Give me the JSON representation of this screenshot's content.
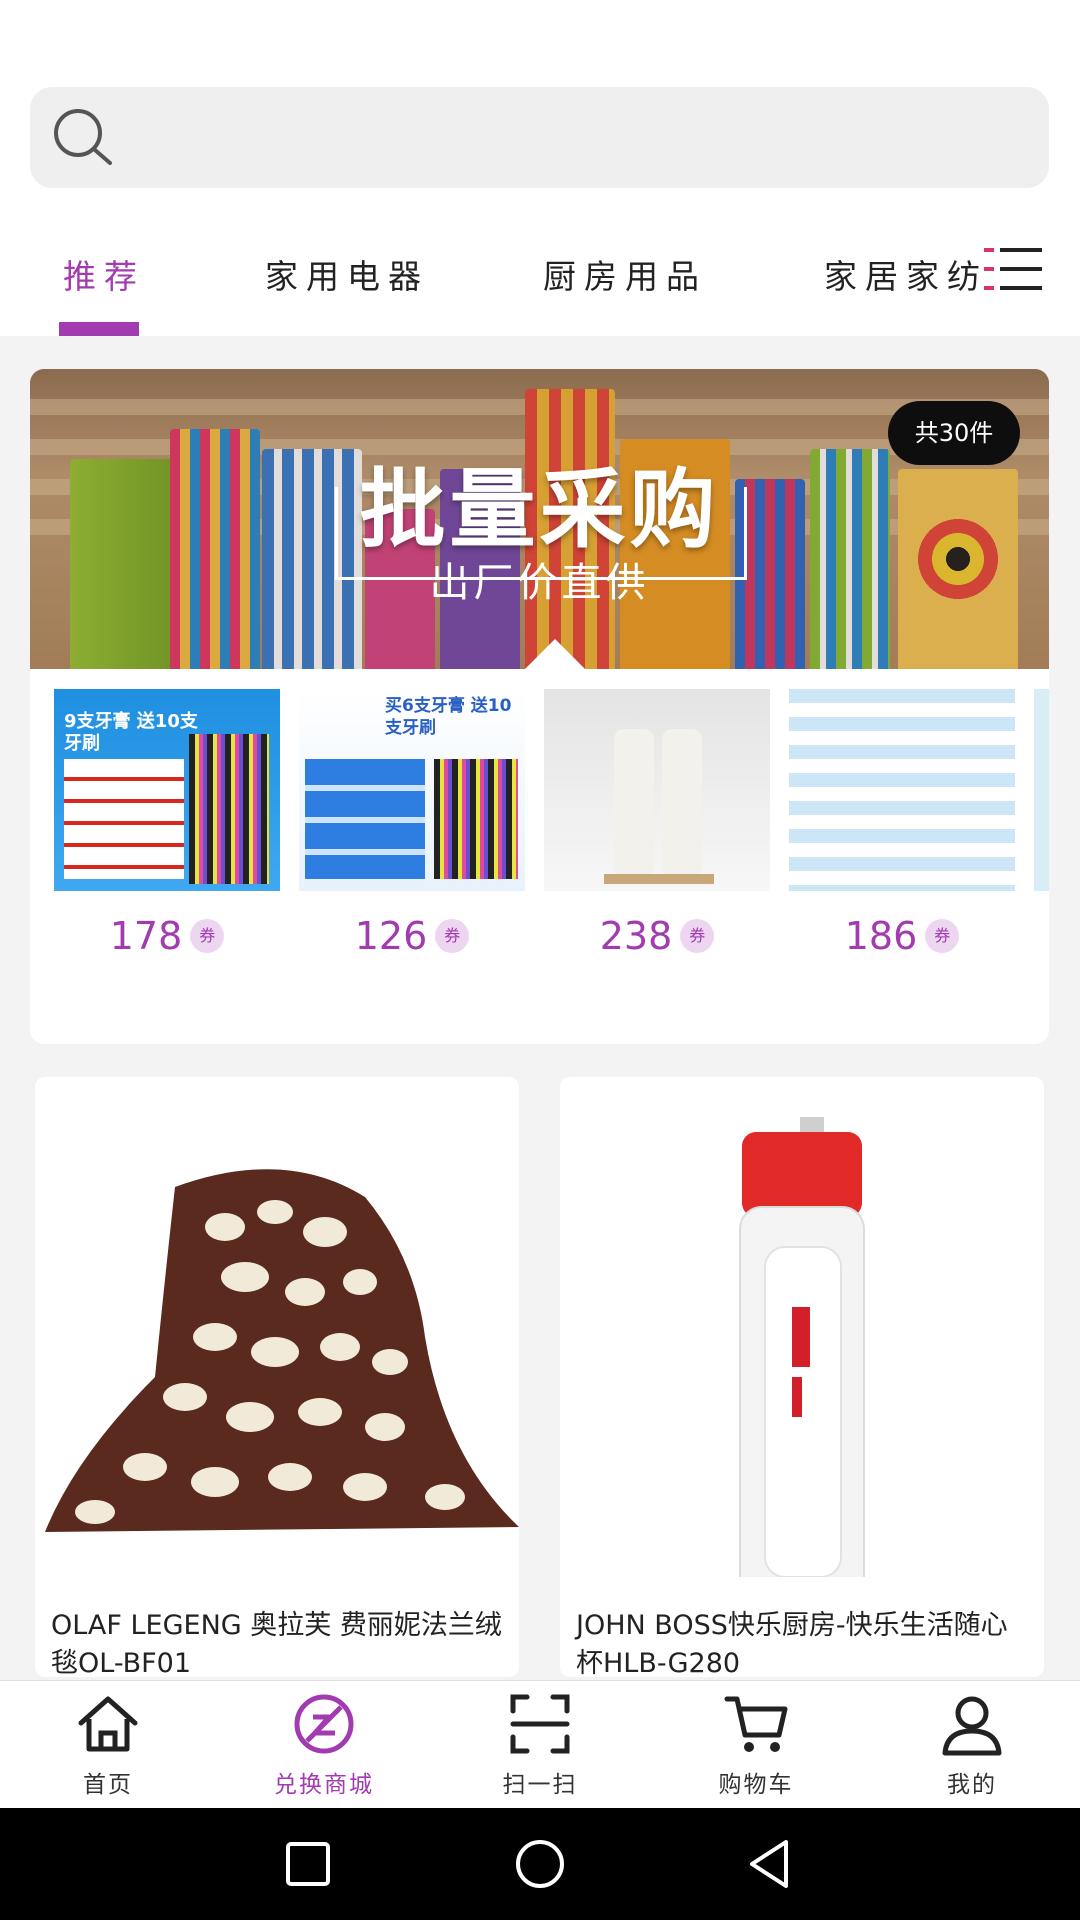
{
  "search": {
    "placeholder": ""
  },
  "tabs": [
    {
      "label": "推荐",
      "active": true
    },
    {
      "label": "家用电器",
      "active": false
    },
    {
      "label": "厨房用品",
      "active": false
    },
    {
      "label": "家居家纺",
      "active": false
    }
  ],
  "banner": {
    "title": "批量采购",
    "subtitle": "出厂价直供",
    "count_badge": "共30件"
  },
  "bulk_products": [
    {
      "price": "178",
      "coupon": "券",
      "image": "toothpaste-toothbrush-set",
      "caption": "9支牙膏 送10支牙刷"
    },
    {
      "price": "126",
      "coupon": "券",
      "image": "crest-toothpaste-set",
      "caption": "买6支牙膏 送10支牙刷"
    },
    {
      "price": "238",
      "coupon": "券",
      "image": "shampoo-bottles"
    },
    {
      "price": "186",
      "coupon": "券",
      "image": "tissue-boxes"
    }
  ],
  "grid_products": [
    {
      "name": "OLAF LEGENG 奥拉芙 费丽妮法兰绒毯OL-BF01",
      "image": "giraffe-pattern-blanket"
    },
    {
      "name": "JOHN BOSS快乐厨房-快乐生活随心杯HLB-G280",
      "image": "red-lid-tumbler"
    }
  ],
  "bottom_nav": [
    {
      "label": "首页",
      "icon": "home-icon",
      "active": false
    },
    {
      "label": "兑换商城",
      "icon": "exchange-icon",
      "active": true
    },
    {
      "label": "扫一扫",
      "icon": "scan-icon",
      "active": false
    },
    {
      "label": "购物车",
      "icon": "cart-icon",
      "active": false
    },
    {
      "label": "我的",
      "icon": "profile-icon",
      "active": false
    }
  ],
  "colors": {
    "accent": "#a23ab0",
    "background": "#f3f3f3",
    "system_bar": "#000000"
  }
}
